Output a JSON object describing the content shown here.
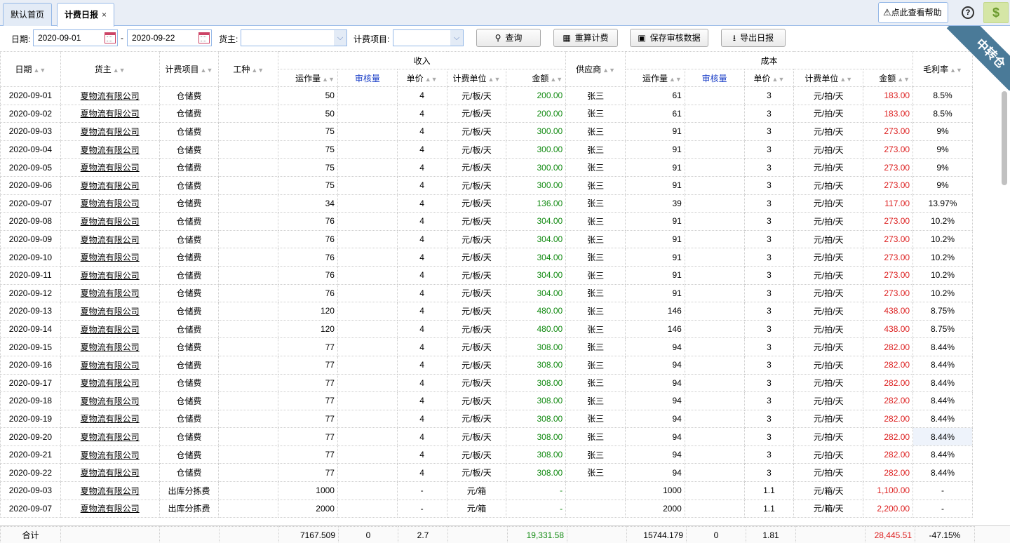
{
  "tabs": [
    {
      "label": "默认首页",
      "active": false
    },
    {
      "label": "计费日报",
      "active": true,
      "close": "×"
    }
  ],
  "topbar": {
    "help_icon": "⚠",
    "help_label": "点此查看帮助",
    "question_icon": "?",
    "dollar_icon": "$",
    "ribbon": "中转仓"
  },
  "toolbar": {
    "date_label": "日期:",
    "date_from": "2020-09-01",
    "date_sep": "-",
    "date_to": "2020-09-22",
    "owner_label": "货主:",
    "owner_value": "",
    "fee_item_label": "计费项目:",
    "fee_item_value": "",
    "query_label": "查询",
    "recalc_label": "重算计费",
    "save_label": "保存审核数据",
    "export_label": "导出日报"
  },
  "grid": {
    "headers": {
      "date": "日期",
      "owner": "货主",
      "fee_item": "计费项目",
      "work_type": "工种",
      "income": "收入",
      "cost": "成本",
      "supplier": "供应商",
      "margin": "毛利率",
      "volume": "运作量",
      "audit": "审核量",
      "price": "单价",
      "unit": "计费单位",
      "amount": "金额"
    },
    "rows": [
      [
        "2020-09-01",
        "夏物流有限公司",
        "仓储费",
        "",
        "50",
        "",
        "4",
        "元/板/天",
        "200.00",
        "张三",
        "61",
        "",
        "3",
        "元/拍/天",
        "183.00",
        "8.5%"
      ],
      [
        "2020-09-02",
        "夏物流有限公司",
        "仓储费",
        "",
        "50",
        "",
        "4",
        "元/板/天",
        "200.00",
        "张三",
        "61",
        "",
        "3",
        "元/拍/天",
        "183.00",
        "8.5%"
      ],
      [
        "2020-09-03",
        "夏物流有限公司",
        "仓储费",
        "",
        "75",
        "",
        "4",
        "元/板/天",
        "300.00",
        "张三",
        "91",
        "",
        "3",
        "元/拍/天",
        "273.00",
        "9%"
      ],
      [
        "2020-09-04",
        "夏物流有限公司",
        "仓储费",
        "",
        "75",
        "",
        "4",
        "元/板/天",
        "300.00",
        "张三",
        "91",
        "",
        "3",
        "元/拍/天",
        "273.00",
        "9%"
      ],
      [
        "2020-09-05",
        "夏物流有限公司",
        "仓储费",
        "",
        "75",
        "",
        "4",
        "元/板/天",
        "300.00",
        "张三",
        "91",
        "",
        "3",
        "元/拍/天",
        "273.00",
        "9%"
      ],
      [
        "2020-09-06",
        "夏物流有限公司",
        "仓储费",
        "",
        "75",
        "",
        "4",
        "元/板/天",
        "300.00",
        "张三",
        "91",
        "",
        "3",
        "元/拍/天",
        "273.00",
        "9%"
      ],
      [
        "2020-09-07",
        "夏物流有限公司",
        "仓储费",
        "",
        "34",
        "",
        "4",
        "元/板/天",
        "136.00",
        "张三",
        "39",
        "",
        "3",
        "元/拍/天",
        "117.00",
        "13.97%"
      ],
      [
        "2020-09-08",
        "夏物流有限公司",
        "仓储费",
        "",
        "76",
        "",
        "4",
        "元/板/天",
        "304.00",
        "张三",
        "91",
        "",
        "3",
        "元/拍/天",
        "273.00",
        "10.2%"
      ],
      [
        "2020-09-09",
        "夏物流有限公司",
        "仓储费",
        "",
        "76",
        "",
        "4",
        "元/板/天",
        "304.00",
        "张三",
        "91",
        "",
        "3",
        "元/拍/天",
        "273.00",
        "10.2%"
      ],
      [
        "2020-09-10",
        "夏物流有限公司",
        "仓储费",
        "",
        "76",
        "",
        "4",
        "元/板/天",
        "304.00",
        "张三",
        "91",
        "",
        "3",
        "元/拍/天",
        "273.00",
        "10.2%"
      ],
      [
        "2020-09-11",
        "夏物流有限公司",
        "仓储费",
        "",
        "76",
        "",
        "4",
        "元/板/天",
        "304.00",
        "张三",
        "91",
        "",
        "3",
        "元/拍/天",
        "273.00",
        "10.2%"
      ],
      [
        "2020-09-12",
        "夏物流有限公司",
        "仓储费",
        "",
        "76",
        "",
        "4",
        "元/板/天",
        "304.00",
        "张三",
        "91",
        "",
        "3",
        "元/拍/天",
        "273.00",
        "10.2%"
      ],
      [
        "2020-09-13",
        "夏物流有限公司",
        "仓储费",
        "",
        "120",
        "",
        "4",
        "元/板/天",
        "480.00",
        "张三",
        "146",
        "",
        "3",
        "元/拍/天",
        "438.00",
        "8.75%"
      ],
      [
        "2020-09-14",
        "夏物流有限公司",
        "仓储费",
        "",
        "120",
        "",
        "4",
        "元/板/天",
        "480.00",
        "张三",
        "146",
        "",
        "3",
        "元/拍/天",
        "438.00",
        "8.75%"
      ],
      [
        "2020-09-15",
        "夏物流有限公司",
        "仓储费",
        "",
        "77",
        "",
        "4",
        "元/板/天",
        "308.00",
        "张三",
        "94",
        "",
        "3",
        "元/拍/天",
        "282.00",
        "8.44%"
      ],
      [
        "2020-09-16",
        "夏物流有限公司",
        "仓储费",
        "",
        "77",
        "",
        "4",
        "元/板/天",
        "308.00",
        "张三",
        "94",
        "",
        "3",
        "元/拍/天",
        "282.00",
        "8.44%"
      ],
      [
        "2020-09-17",
        "夏物流有限公司",
        "仓储费",
        "",
        "77",
        "",
        "4",
        "元/板/天",
        "308.00",
        "张三",
        "94",
        "",
        "3",
        "元/拍/天",
        "282.00",
        "8.44%"
      ],
      [
        "2020-09-18",
        "夏物流有限公司",
        "仓储费",
        "",
        "77",
        "",
        "4",
        "元/板/天",
        "308.00",
        "张三",
        "94",
        "",
        "3",
        "元/拍/天",
        "282.00",
        "8.44%"
      ],
      [
        "2020-09-19",
        "夏物流有限公司",
        "仓储费",
        "",
        "77",
        "",
        "4",
        "元/板/天",
        "308.00",
        "张三",
        "94",
        "",
        "3",
        "元/拍/天",
        "282.00",
        "8.44%"
      ],
      [
        "2020-09-20",
        "夏物流有限公司",
        "仓储费",
        "",
        "77",
        "",
        "4",
        "元/板/天",
        "308.00",
        "张三",
        "94",
        "",
        "3",
        "元/拍/天",
        "282.00",
        "8.44%"
      ],
      [
        "2020-09-21",
        "夏物流有限公司",
        "仓储费",
        "",
        "77",
        "",
        "4",
        "元/板/天",
        "308.00",
        "张三",
        "94",
        "",
        "3",
        "元/拍/天",
        "282.00",
        "8.44%"
      ],
      [
        "2020-09-22",
        "夏物流有限公司",
        "仓储费",
        "",
        "77",
        "",
        "4",
        "元/板/天",
        "308.00",
        "张三",
        "94",
        "",
        "3",
        "元/拍/天",
        "282.00",
        "8.44%"
      ],
      [
        "2020-09-03",
        "夏物流有限公司",
        "出库分拣费",
        "",
        "1000",
        "",
        "-",
        "元/箱",
        "-",
        "",
        "1000",
        "",
        "1.1",
        "元/箱/天",
        "1,100.00",
        "-"
      ],
      [
        "2020-09-07",
        "夏物流有限公司",
        "出库分拣费",
        "",
        "2000",
        "",
        "-",
        "元/箱",
        "-",
        "",
        "2000",
        "",
        "1.1",
        "元/箱/天",
        "2,200.00",
        "-"
      ]
    ],
    "totals": [
      "合计",
      "",
      "",
      "",
      "7167.509",
      "0",
      "2.7",
      "",
      "19,331.58",
      "",
      "15744.179",
      "0",
      "1.81",
      "",
      "28,445.51",
      "-47.15%"
    ]
  },
  "colors": {
    "income_amount": "#138b13",
    "cost_amount": "#dd2222",
    "audit_header": "#1b3fc7",
    "ribbon": "#4a7a98"
  }
}
